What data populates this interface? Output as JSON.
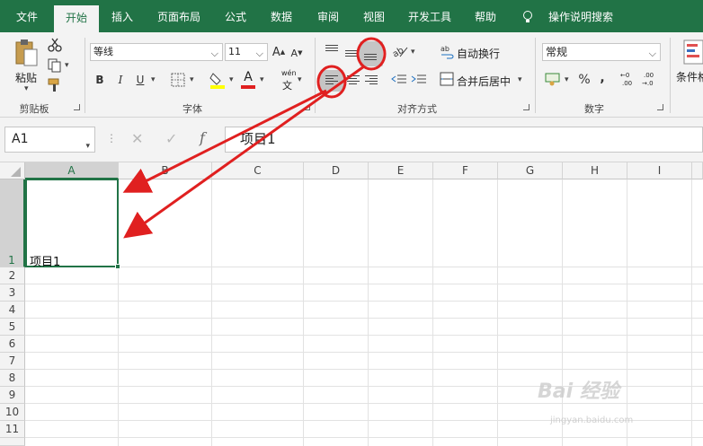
{
  "tabs": [
    "文件",
    "开始",
    "插入",
    "页面布局",
    "公式",
    "数据",
    "审阅",
    "视图",
    "开发工具",
    "帮助"
  ],
  "active_tab": "开始",
  "tell_me": "操作说明搜索",
  "groups": {
    "clipboard": {
      "label": "剪贴板",
      "paste": "粘贴"
    },
    "font": {
      "label": "字体",
      "font_name": "等线",
      "font_size": "11",
      "bold": "B",
      "italic": "I",
      "underline": "U",
      "font_color_letter": "A",
      "grow": "A",
      "shrink": "A",
      "phonetic_top": "wén",
      "phonetic_bottom": "文"
    },
    "alignment": {
      "label": "对齐方式",
      "wrap_text": "自动换行",
      "merge_center": "合并后居中"
    },
    "number": {
      "label": "数字",
      "format": "常规",
      "percent": "%",
      "comma": ",",
      "inc_top": "←0",
      "inc_bottom": ".00",
      "dec_top": ".00",
      "dec_bottom": "→.0"
    },
    "styles": {
      "cond_format": "条件格"
    }
  },
  "formula_bar": {
    "name_box": "A1",
    "fx": "f",
    "content": "项目1"
  },
  "columns": [
    "A",
    "B",
    "C",
    "D",
    "E",
    "F",
    "G",
    "H",
    "I"
  ],
  "rows": [
    "1",
    "2",
    "3",
    "4",
    "5",
    "6",
    "7",
    "8",
    "9",
    "10",
    "11"
  ],
  "cells": {
    "A1": "项目1"
  },
  "selected_cell": "A1",
  "colors": {
    "accent": "#217346",
    "annotation": "#e02020"
  },
  "watermark": {
    "main": "Bai 经验",
    "sub": "jingyan.baidu.com"
  }
}
